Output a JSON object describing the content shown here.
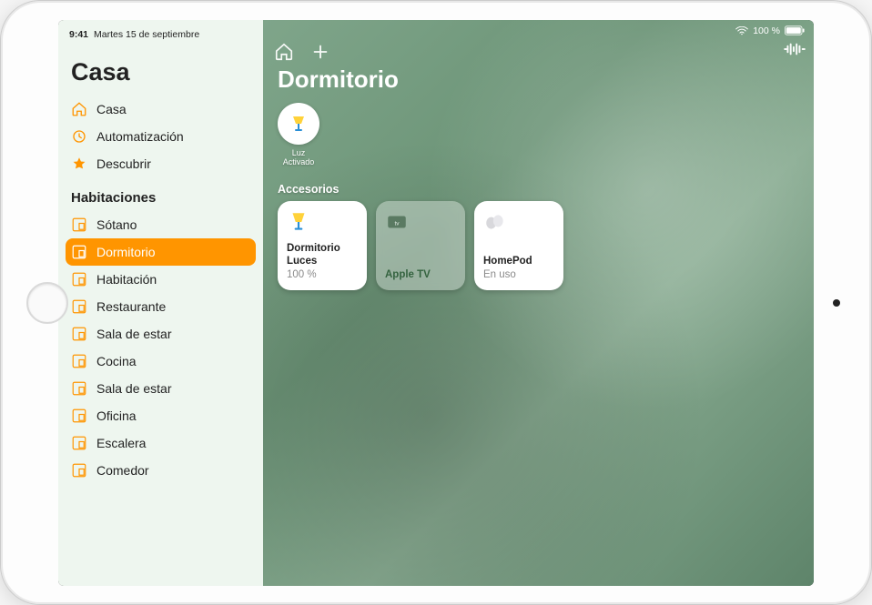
{
  "status": {
    "time": "9:41",
    "date": "Martes 15 de septiembre",
    "battery_text": "100 %",
    "charging": true
  },
  "sidebar": {
    "title": "Casa",
    "nav": [
      {
        "id": "home",
        "label": "Casa",
        "icon": "home-outline-icon"
      },
      {
        "id": "automation",
        "label": "Automatización",
        "icon": "clock-icon"
      },
      {
        "id": "discover",
        "label": "Descubrir",
        "icon": "star-icon"
      }
    ],
    "rooms_label": "Habitaciones",
    "rooms": [
      {
        "label": "Sótano"
      },
      {
        "label": "Dormitorio",
        "selected": true
      },
      {
        "label": "Habitación"
      },
      {
        "label": "Restaurante"
      },
      {
        "label": "Sala de estar"
      },
      {
        "label": "Cocina"
      },
      {
        "label": "Sala de estar"
      },
      {
        "label": "Oficina"
      },
      {
        "label": "Escalera"
      },
      {
        "label": "Comedor"
      }
    ]
  },
  "main": {
    "title": "Dormitorio",
    "scene": {
      "line1": "Luz",
      "line2": "Activado"
    },
    "accessories_label": "Accesorios",
    "tiles": [
      {
        "kind": "light",
        "name": "Dormitorio Luces",
        "sub": "100 %"
      },
      {
        "kind": "appletv",
        "name": "Apple TV",
        "sub": ""
      },
      {
        "kind": "homepod",
        "name": "HomePod",
        "sub": "En uso"
      }
    ]
  }
}
